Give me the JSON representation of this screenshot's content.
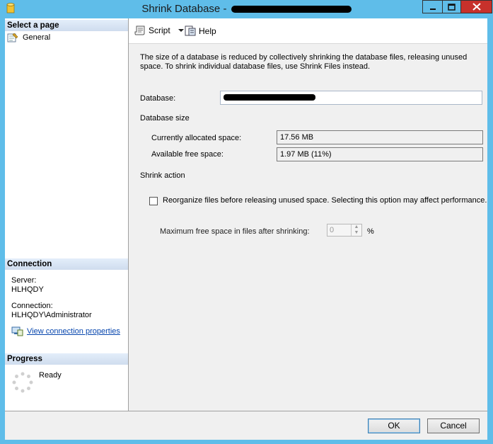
{
  "window": {
    "title": "Shrink Database - "
  },
  "left_panel": {
    "select_page_header": "Select a page",
    "pages": [
      {
        "label": "General"
      }
    ],
    "connection_header": "Connection",
    "server_label": "Server:",
    "server_value": "HLHQDY",
    "connection_label": "Connection:",
    "connection_value": "HLHQDY\\Administrator",
    "view_connection_link": "View connection properties",
    "progress_header": "Progress",
    "progress_status": "Ready"
  },
  "toolbar": {
    "script_label": "Script",
    "help_label": "Help"
  },
  "main": {
    "description": "The size of a database is reduced by collectively shrinking the database files, releasing unused space. To shrink individual database files, use Shrink Files instead.",
    "database_label": "Database:",
    "database_size_header": "Database size",
    "allocated_label": "Currently allocated space:",
    "allocated_value": "17.56 MB",
    "free_label": "Available free space:",
    "free_value": "1.97 MB (11%)",
    "shrink_action_header": "Shrink action",
    "reorganize_label": "Reorganize files before releasing unused space.  Selecting this option may affect performance.",
    "reorganize_checked": false,
    "max_free_label": "Maximum free space in files after shrinking:",
    "max_free_value": "0",
    "percent_sign": "%"
  },
  "buttons": {
    "ok_label": "OK",
    "cancel_label": "Cancel"
  }
}
